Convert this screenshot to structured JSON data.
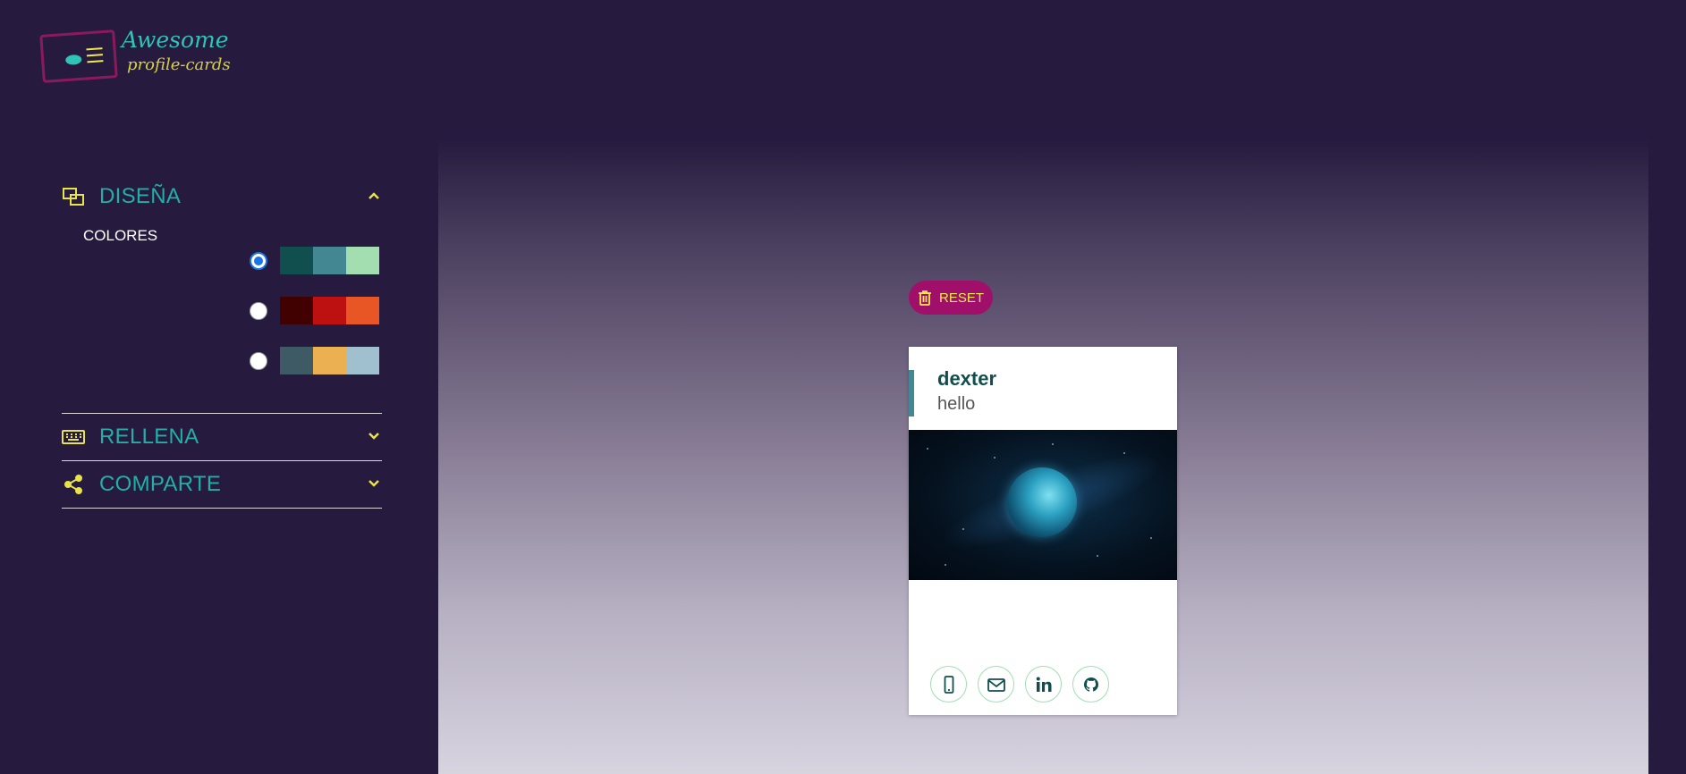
{
  "logo": {
    "line1": "Awesome",
    "line2": "profile-cards"
  },
  "sidebar": {
    "design": {
      "title": "DISEÑA",
      "icon": "layout-icon",
      "expanded": true
    },
    "colors": {
      "label": "COLORES",
      "palettes": [
        {
          "selected": true,
          "colors": [
            "#114e4e",
            "#438792",
            "#a2deaf"
          ]
        },
        {
          "selected": false,
          "colors": [
            "#420101",
            "#bd1010",
            "#e95626"
          ]
        },
        {
          "selected": false,
          "colors": [
            "#3e5b65",
            "#eab052",
            "#a0c0cf"
          ]
        }
      ]
    },
    "fill": {
      "title": "RELLENA",
      "icon": "keyboard-icon"
    },
    "share": {
      "title": "COMPARTE",
      "icon": "share-icon"
    }
  },
  "preview": {
    "reset_label": "RESET",
    "card": {
      "name": "dexter",
      "job": "hello",
      "socials": [
        "phone-icon",
        "mail-icon",
        "linkedin-icon",
        "github-icon"
      ]
    }
  }
}
